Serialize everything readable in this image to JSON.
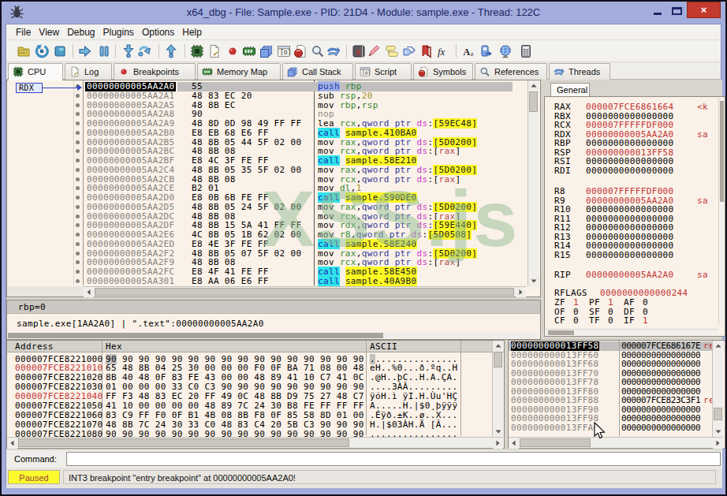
{
  "window": {
    "title": "x64_dbg - File: Sample.exe - PID: 21D4 - Module: sample.exe - Thread: 122C",
    "controls": {
      "minimize": "minimize",
      "maximize": "maximize",
      "close": "×"
    }
  },
  "menu": {
    "items": [
      "File",
      "View",
      "Debug",
      "Plugins",
      "Options",
      "Help"
    ]
  },
  "toolbar": {
    "icons": [
      "open-folder",
      "restart",
      "stop",
      "run",
      "pause",
      "step-into",
      "step-over",
      "run-to-return",
      "cpu-chip",
      "log-page",
      "breakpoint-dot",
      "memory-map",
      "call-stack",
      "script-window",
      "symbols-orb",
      "references-magnifier",
      "threads-arrows",
      "seh-chain",
      "highlight-pen",
      "comments",
      "labels",
      "bookmarks",
      "functions-fx",
      "ascii-table",
      "debug-device",
      "globe",
      "calculator"
    ]
  },
  "tabs": [
    {
      "label": "CPU",
      "icon": "cpu-chip",
      "active": true
    },
    {
      "label": "Log",
      "icon": "log-page",
      "active": false
    },
    {
      "label": "Breakpoints",
      "icon": "breakpoint-dot",
      "active": false
    },
    {
      "label": "Memory Map",
      "icon": "memory-map",
      "active": false
    },
    {
      "label": "Call Stack",
      "icon": "call-stack",
      "active": false
    },
    {
      "label": "Script",
      "icon": "script-window",
      "active": false
    },
    {
      "label": "Symbols",
      "icon": "symbols-orb",
      "active": false
    },
    {
      "label": "References",
      "icon": "references-magnifier",
      "active": false
    },
    {
      "label": "Threads",
      "icon": "threads-arrows",
      "active": false
    }
  ],
  "disasm": {
    "register_label": "RDX",
    "rows": [
      {
        "a": "00000000005AA2A0",
        "h": "55",
        "sel": true,
        "t": [
          [
            "push",
            "isel"
          ],
          [
            " ",
            "pl"
          ],
          [
            "rbp",
            "reg"
          ]
        ]
      },
      {
        "a": "00000000005AA2A1",
        "h": "48 83 EC 20",
        "t": [
          [
            "sub ",
            "mn"
          ],
          [
            "rsp",
            "reg"
          ],
          [
            ",",
            "pl"
          ],
          [
            "20",
            "num"
          ]
        ]
      },
      {
        "a": "00000000005AA2A5",
        "h": "48 8B EC",
        "t": [
          [
            "mov ",
            "mn"
          ],
          [
            "rbp",
            "reg"
          ],
          [
            ",",
            "pl"
          ],
          [
            "rsp",
            "reg"
          ]
        ]
      },
      {
        "a": "00000000005AA2A8",
        "h": "90",
        "t": [
          [
            "nop",
            "gray"
          ]
        ]
      },
      {
        "a": "00000000005AA2A9",
        "h": "48 8D 0D 98 49 FF FF",
        "t": [
          [
            "lea ",
            "mn"
          ],
          [
            "rcx",
            "reg"
          ],
          [
            ",",
            "pl"
          ],
          [
            "qword ptr ",
            "kw"
          ],
          [
            "ds",
            "seg"
          ],
          [
            ":",
            "pl"
          ],
          [
            "[59EC48]",
            "mem"
          ]
        ]
      },
      {
        "a": "00000000005AA2B0",
        "h": "E8 EB 68 E6 FF",
        "t": [
          [
            "call",
            "call"
          ],
          [
            " ",
            "pl"
          ],
          [
            "sample.410BA0",
            "tgt"
          ]
        ]
      },
      {
        "a": "00000000005AA2B5",
        "h": "48 8B 05 44 5F 02 00",
        "t": [
          [
            "mov ",
            "mn"
          ],
          [
            "rax",
            "reg"
          ],
          [
            ",",
            "pl"
          ],
          [
            "qword ptr ",
            "kw"
          ],
          [
            "ds",
            "seg"
          ],
          [
            ":",
            "pl"
          ],
          [
            "[5D0200]",
            "mem"
          ]
        ]
      },
      {
        "a": "00000000005AA2BC",
        "h": "48 8B 08",
        "t": [
          [
            "mov ",
            "mn"
          ],
          [
            "rcx",
            "reg"
          ],
          [
            ",",
            "pl"
          ],
          [
            "qword ptr ",
            "kw"
          ],
          [
            "ds",
            "seg"
          ],
          [
            ":",
            "pl"
          ],
          [
            "[",
            "pl"
          ],
          [
            "rax",
            "memreg"
          ],
          [
            "]",
            "pl"
          ]
        ]
      },
      {
        "a": "00000000005AA2BF",
        "h": "E8 4C 3F FE FF",
        "t": [
          [
            "call",
            "call"
          ],
          [
            " ",
            "pl"
          ],
          [
            "sample.58E210",
            "tgt"
          ]
        ]
      },
      {
        "a": "00000000005AA2C4",
        "h": "48 8B 05 35 5F 02 00",
        "t": [
          [
            "mov ",
            "mn"
          ],
          [
            "rax",
            "reg"
          ],
          [
            ",",
            "pl"
          ],
          [
            "qword ptr ",
            "kw"
          ],
          [
            "ds",
            "seg"
          ],
          [
            ":",
            "pl"
          ],
          [
            "[5D0200]",
            "mem"
          ]
        ]
      },
      {
        "a": "00000000005AA2CB",
        "h": "48 8B 08",
        "t": [
          [
            "mov ",
            "mn"
          ],
          [
            "rcx",
            "reg"
          ],
          [
            ",",
            "pl"
          ],
          [
            "qword ptr ",
            "kw"
          ],
          [
            "ds",
            "seg"
          ],
          [
            ":",
            "pl"
          ],
          [
            "[",
            "pl"
          ],
          [
            "rax",
            "memreg"
          ],
          [
            "]",
            "pl"
          ]
        ]
      },
      {
        "a": "00000000005AA2CE",
        "h": "B2 01",
        "t": [
          [
            "mov ",
            "mn"
          ],
          [
            "dl",
            "reg"
          ],
          [
            ",",
            "pl"
          ],
          [
            "1",
            "num"
          ]
        ]
      },
      {
        "a": "00000000005AA2D0",
        "h": "E8 0B 6B FE FF",
        "t": [
          [
            "call",
            "call"
          ],
          [
            " ",
            "pl"
          ],
          [
            "sample.590DE0",
            "tgt"
          ]
        ]
      },
      {
        "a": "00000000005AA2D5",
        "h": "48 8B 05 24 5F 02 00",
        "t": [
          [
            "mov ",
            "mn"
          ],
          [
            "rax",
            "reg"
          ],
          [
            ",",
            "pl"
          ],
          [
            "qword ptr ",
            "kw"
          ],
          [
            "ds",
            "seg"
          ],
          [
            ":",
            "pl"
          ],
          [
            "[5D0200]",
            "mem"
          ]
        ]
      },
      {
        "a": "00000000005AA2DC",
        "h": "48 8B 08",
        "t": [
          [
            "mov ",
            "mn"
          ],
          [
            "rcx",
            "reg"
          ],
          [
            ",",
            "pl"
          ],
          [
            "qword ptr ",
            "kw"
          ],
          [
            "ds",
            "seg"
          ],
          [
            ":",
            "pl"
          ],
          [
            "[",
            "pl"
          ],
          [
            "rax",
            "memreg"
          ],
          [
            "]",
            "pl"
          ]
        ]
      },
      {
        "a": "00000000005AA2DF",
        "h": "48 8B 15 5A 41 FF FF",
        "t": [
          [
            "mov ",
            "mn"
          ],
          [
            "rdx",
            "reg"
          ],
          [
            ",",
            "pl"
          ],
          [
            "qword ptr ",
            "kw"
          ],
          [
            "ds",
            "seg"
          ],
          [
            ":",
            "pl"
          ],
          [
            "[59E440]",
            "mem"
          ]
        ]
      },
      {
        "a": "00000000005AA2E6",
        "h": "4C 8B 05 1B 62 02 00",
        "t": [
          [
            "mov ",
            "mn"
          ],
          [
            "r8",
            "reg"
          ],
          [
            ",",
            "pl"
          ],
          [
            "qword ptr ",
            "kw"
          ],
          [
            "ds",
            "seg"
          ],
          [
            ":",
            "pl"
          ],
          [
            "[5D0508]",
            "mem"
          ]
        ]
      },
      {
        "a": "00000000005AA2ED",
        "h": "E8 4E 3F FE FF",
        "t": [
          [
            "call",
            "call"
          ],
          [
            " ",
            "pl"
          ],
          [
            "sample.58E240",
            "tgt"
          ]
        ]
      },
      {
        "a": "00000000005AA2F2",
        "h": "48 8B 05 07 5F 02 00",
        "t": [
          [
            "mov ",
            "mn"
          ],
          [
            "rax",
            "reg"
          ],
          [
            ",",
            "pl"
          ],
          [
            "qword ptr ",
            "kw"
          ],
          [
            "ds",
            "seg"
          ],
          [
            ":",
            "pl"
          ],
          [
            "[5D0200]",
            "mem"
          ]
        ]
      },
      {
        "a": "00000000005AA2F9",
        "h": "48 8B 08",
        "t": [
          [
            "mov ",
            "mn"
          ],
          [
            "rcx",
            "reg"
          ],
          [
            ",",
            "pl"
          ],
          [
            "qword ptr ",
            "kw"
          ],
          [
            "ds",
            "seg"
          ],
          [
            ":",
            "pl"
          ],
          [
            "[",
            "pl"
          ],
          [
            "rax",
            "memreg"
          ],
          [
            "]",
            "pl"
          ]
        ]
      },
      {
        "a": "00000000005AA2FC",
        "h": "E8 4F 41 FE FF",
        "t": [
          [
            "call",
            "call"
          ],
          [
            " ",
            "pl"
          ],
          [
            "sample.58E450",
            "tgt"
          ]
        ]
      },
      {
        "a": "00000000005AA301",
        "h": "E8 AA 06 E6 FF",
        "t": [
          [
            "call",
            "call"
          ],
          [
            " ",
            "pl"
          ],
          [
            "sample.40A9B0",
            "tgt"
          ]
        ]
      }
    ]
  },
  "registers": {
    "tab": "General",
    "gpr": [
      {
        "n": "RAX",
        "v": "000007FCE6861664",
        "red": true,
        "suffix": "<k"
      },
      {
        "n": "RBX",
        "v": "0000000000000000",
        "red": false,
        "suffix": ""
      },
      {
        "n": "RCX",
        "v": "000007FFFFFDF000",
        "red": true,
        "suffix": ""
      },
      {
        "n": "RDX",
        "v": "00000000005AA2A0",
        "red": true,
        "suffix": "sa"
      },
      {
        "n": "RBP",
        "v": "0000000000000000",
        "red": false,
        "suffix": ""
      },
      {
        "n": "RSP",
        "v": "000000000013FF58",
        "red": true,
        "suffix": ""
      },
      {
        "n": "RSI",
        "v": "0000000000000000",
        "red": false,
        "suffix": ""
      },
      {
        "n": "RDI",
        "v": "0000000000000000",
        "red": false,
        "suffix": ""
      }
    ],
    "r8_15": [
      {
        "n": "R8",
        "v": "000007FFFFFDF000",
        "red": true,
        "suffix": ""
      },
      {
        "n": "R9",
        "v": "00000000005AA2A0",
        "red": true,
        "suffix": "sa"
      },
      {
        "n": "R10",
        "v": "0000000000000000",
        "red": false,
        "suffix": ""
      },
      {
        "n": "R11",
        "v": "0000000000000000",
        "red": false,
        "suffix": ""
      },
      {
        "n": "R12",
        "v": "0000000000000000",
        "red": false,
        "suffix": ""
      },
      {
        "n": "R13",
        "v": "0000000000000000",
        "red": false,
        "suffix": ""
      },
      {
        "n": "R14",
        "v": "0000000000000000",
        "red": false,
        "suffix": ""
      },
      {
        "n": "R15",
        "v": "0000000000000000",
        "red": false,
        "suffix": ""
      }
    ],
    "rip": {
      "n": "RIP",
      "v": "00000000005AA2A0",
      "red": true,
      "suffix": "sa"
    },
    "rflags": {
      "n": "RFLAGS",
      "v": "0000000000000244"
    },
    "flags": [
      [
        [
          "ZF",
          "1",
          true
        ],
        [
          "PF",
          "1",
          true
        ],
        [
          "AF",
          "0",
          false
        ]
      ],
      [
        [
          "OF",
          "0",
          false
        ],
        [
          "SF",
          "0",
          false
        ],
        [
          "DF",
          "0",
          false
        ]
      ],
      [
        [
          "CF",
          "0",
          false
        ],
        [
          "TF",
          "0",
          false
        ],
        [
          "IF",
          "1",
          true
        ]
      ]
    ]
  },
  "info": {
    "line1": "rbp=0",
    "line2": "sample.exe[1AA2A0]  |  \".text\":00000000005AA2A0"
  },
  "dump": {
    "headers": [
      "Address",
      "Hex",
      "ASCII"
    ],
    "rows": [
      {
        "addr": "000007FCE8221000",
        "red": false,
        "selFirst": true,
        "hex": "90 90 90 90 90 90 90 90 90 90 90 90 90 90 90 90",
        "ascii": "................"
      },
      {
        "addr": "000007FCE8221010",
        "red": true,
        "hex": "65 48 8B 04 25 30 00 00 00 F0 0F BA 71 08 00 48",
        "ascii": "eH..%0...ð.ºq..H"
      },
      {
        "addr": "000007FCE8221020",
        "red": false,
        "hex": "8B 40 48 0F 83 FE 43 00 00 48 89 41 10 C7 41 0C",
        "ascii": ".@H..þC..H.A.ÇA."
      },
      {
        "addr": "000007FCE8221030",
        "red": false,
        "hex": "01 00 00 00 33 C0 C3 90 90 90 90 90 90 90 90 90",
        "ascii": "....3ÀÃ........."
      },
      {
        "addr": "000007FCE8221040",
        "red": true,
        "hex": "FF F3 48 83 EC 20 FF 49 0C 48 8B D9 75 27 48 C7",
        "ascii": "ÿóH.ì ÿI.H.Ùu'HÇ"
      },
      {
        "addr": "000007FCE8221050",
        "red": false,
        "hex": "41 10 00 00 00 00 48 89 7C 24 30 B8 FE FF FF FF",
        "ascii": "A.....H.|$0¸þÿÿÿ"
      },
      {
        "addr": "000007FCE8221060",
        "red": false,
        "hex": "83 C9 FF F0 0F B1 4B 08 8B F8 0F 85 58 8D 01 00",
        "ascii": ".Éÿð.±K..ø..X..."
      },
      {
        "addr": "000007FCE8221070",
        "red": false,
        "hex": "48 8B 7C 24 30 33 C0 48 83 C4 20 5B C3 90 90 90",
        "ascii": "H.|$03ÀH.Ä [Ã..."
      },
      {
        "addr": "000007FCE8221080",
        "red": false,
        "hex": "90 90 90 90 90 90 90 90 90 90 90 90 90 90 90 90",
        "ascii": "................"
      }
    ]
  },
  "stack": {
    "rows": [
      {
        "addr": "000000000013FF58",
        "val": "000007FCE686167E",
        "ann": "re",
        "sel": true
      },
      {
        "addr": "000000000013FF60",
        "val": "0000000000000000",
        "ann": ""
      },
      {
        "addr": "000000000013FF68",
        "val": "0000000000000000",
        "ann": ""
      },
      {
        "addr": "000000000013FF70",
        "val": "0000000000000000",
        "ann": ""
      },
      {
        "addr": "000000000013FF78",
        "val": "0000000000000000",
        "ann": ""
      },
      {
        "addr": "000000000013FF80",
        "val": "0000000000000000",
        "ann": ""
      },
      {
        "addr": "000000000013FF88",
        "val": "000007FCE823C3F1",
        "ann": "re"
      },
      {
        "addr": "000000000013FF90",
        "val": "0000000000000000",
        "ann": ""
      },
      {
        "addr": "000000000013FF98",
        "val": "0000000000000000",
        "ann": ""
      },
      {
        "addr": "000000000013FFA0",
        "val": "0000000000000000",
        "ann": ""
      }
    ]
  },
  "command": {
    "label": "Command:",
    "value": ""
  },
  "status": {
    "state": "Paused",
    "message": "INT3 breakpoint \"entry breakpoint\" at 00000000005AA2A0!"
  },
  "watermark": "XSS.js"
}
